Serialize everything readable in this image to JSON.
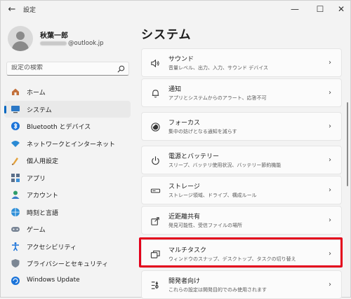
{
  "window": {
    "back": "←",
    "title": "設定",
    "minimize": "—",
    "maximize": "☐",
    "close": "✕"
  },
  "user": {
    "name": "秋葉一郎",
    "email_suffix": "@outlook.jp"
  },
  "search": {
    "placeholder": "設定の検索"
  },
  "nav": [
    {
      "label": "ホーム",
      "icon": "home-icon"
    },
    {
      "label": "システム",
      "icon": "system-icon",
      "active": true
    },
    {
      "label": "Bluetooth とデバイス",
      "icon": "bluetooth-icon"
    },
    {
      "label": "ネットワークとインターネット",
      "icon": "network-icon"
    },
    {
      "label": "個人用設定",
      "icon": "personalization-icon"
    },
    {
      "label": "アプリ",
      "icon": "apps-icon"
    },
    {
      "label": "アカウント",
      "icon": "account-icon"
    },
    {
      "label": "時刻と言語",
      "icon": "time-language-icon"
    },
    {
      "label": "ゲーム",
      "icon": "gaming-icon"
    },
    {
      "label": "アクセシビリティ",
      "icon": "accessibility-icon"
    },
    {
      "label": "プライバシーとセキュリティ",
      "icon": "privacy-icon"
    },
    {
      "label": "Windows Update",
      "icon": "windows-update-icon"
    }
  ],
  "main": {
    "title": "システム",
    "cards": [
      {
        "title": "サウンド",
        "sub": "音量レベル、出力、入力、サウンド デバイス",
        "icon": "speaker-icon"
      },
      {
        "title": "通知",
        "sub": "アプリとシステムからのアラート、応答不可",
        "icon": "bell-icon"
      },
      {
        "title": "フォーカス",
        "sub": "集中の妨げとなる通知を減らす",
        "icon": "focus-icon"
      },
      {
        "title": "電源とバッテリー",
        "sub": "スリープ、バッテリ使用状況、バッテリー節約機能",
        "icon": "power-icon"
      },
      {
        "title": "ストレージ",
        "sub": "ストレージ領域、ドライブ、構成ルール",
        "icon": "storage-icon"
      },
      {
        "title": "近距離共有",
        "sub": "発見可能性、受信ファイルの場所",
        "icon": "share-icon"
      },
      {
        "title": "マルチタスク",
        "sub": "ウィンドウのスナップ、デスクトップ、タスクの切り替え",
        "icon": "multitask-icon"
      },
      {
        "title": "開発者向け",
        "sub": "これらの設定は開発目的でのみ使用されます",
        "icon": "developer-icon"
      }
    ],
    "chevron": "›"
  },
  "colors": {
    "accent": "#0067c0",
    "highlight": "#e3001b",
    "background": "#f3f3f3"
  }
}
